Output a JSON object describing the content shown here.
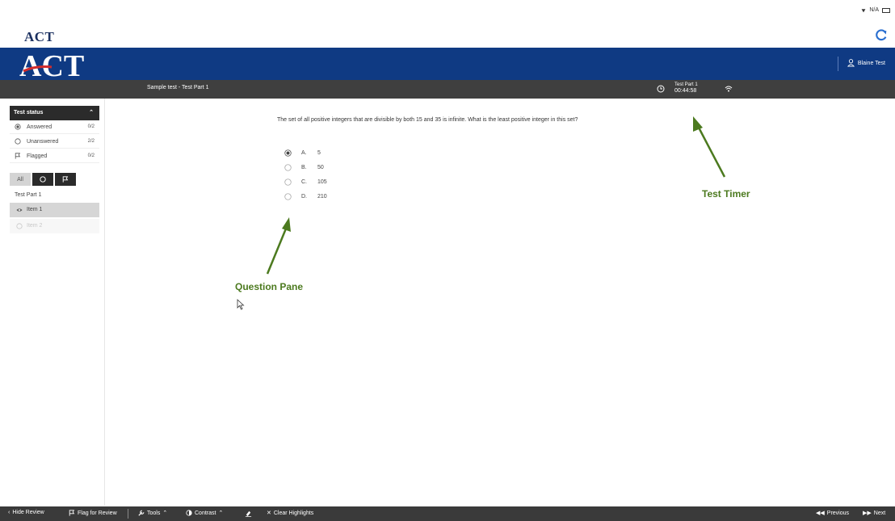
{
  "system": {
    "network_status": "N/A"
  },
  "brand": {
    "small_logo_text": "ACT",
    "logo_text": "ACT",
    "user_name": "Blaine Test"
  },
  "title_bar": {
    "test_title": "Sample test - Test Part 1",
    "timer_part": "Test Part 1",
    "timer_value": "00:44:58"
  },
  "sidebar": {
    "status_title": "Test status",
    "status_rows": [
      {
        "label": "Answered",
        "count": "0/2"
      },
      {
        "label": "Unanswered",
        "count": "2/2"
      },
      {
        "label": "Flagged",
        "count": "0/2"
      }
    ],
    "filter_all": "All",
    "part_label": "Test Part 1",
    "items": [
      {
        "label": "Item 1"
      },
      {
        "label": "Item 2"
      }
    ]
  },
  "question": {
    "prompt": "The set of all positive integers that are divisible by both 15 and 35 is infinite. What is the least positive integer in this set?",
    "selected_option": "A",
    "options": [
      {
        "letter": "A.",
        "value": "5"
      },
      {
        "letter": "B.",
        "value": "50"
      },
      {
        "letter": "C.",
        "value": "105"
      },
      {
        "letter": "D.",
        "value": "210"
      }
    ]
  },
  "annotations": {
    "timer_label": "Test Timer",
    "question_label": "Question Pane",
    "color": "#4c7a1f"
  },
  "toolbar": {
    "hide_review": "Hide Review",
    "flag_for_review": "Flag for Review",
    "tools": "Tools",
    "contrast": "Contrast",
    "clear_highlights": "Clear Highlights",
    "previous": "Previous",
    "next": "Next"
  },
  "colors": {
    "brand_blue": "#0f3a83",
    "dark_bar": "#3f3f3f",
    "annotation_green": "#4c7a1f"
  }
}
